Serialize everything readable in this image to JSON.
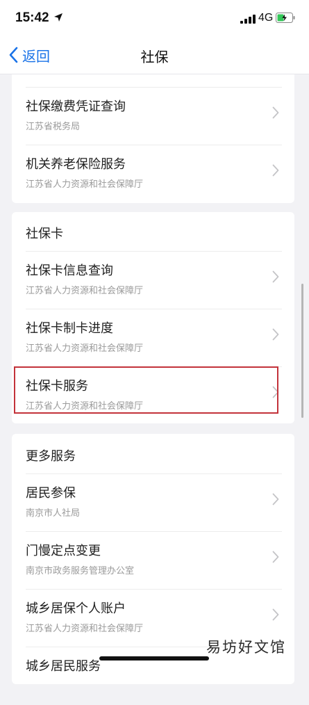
{
  "status_bar": {
    "time": "15:42",
    "network": "4G",
    "battery_color": "#34c759"
  },
  "nav": {
    "back_label": "返回",
    "title": "社保",
    "accent": "#1a73e8"
  },
  "card_top": {
    "items": [
      {
        "title": "社保缴费凭证查询",
        "subtitle": "江苏省税务局"
      },
      {
        "title": "机关养老保险服务",
        "subtitle": "江苏省人力资源和社会保障厅"
      }
    ]
  },
  "card_social_card": {
    "header": "社保卡",
    "items": [
      {
        "title": "社保卡信息查询",
        "subtitle": "江苏省人力资源和社会保障厅"
      },
      {
        "title": "社保卡制卡进度",
        "subtitle": "江苏省人力资源和社会保障厅"
      },
      {
        "title": "社保卡服务",
        "subtitle": "江苏省人力资源和社会保障厅"
      }
    ]
  },
  "card_more": {
    "header": "更多服务",
    "items": [
      {
        "title": "居民参保",
        "subtitle": "南京市人社局"
      },
      {
        "title": "门慢定点变更",
        "subtitle": "南京市政务服务管理办公室"
      },
      {
        "title": "城乡居保个人账户",
        "subtitle": "江苏省人力资源和社会保障厅"
      },
      {
        "title": "城乡居民服务",
        "subtitle": ""
      }
    ]
  },
  "highlight_color": "#c3323a",
  "watermark": "易坊好文馆"
}
